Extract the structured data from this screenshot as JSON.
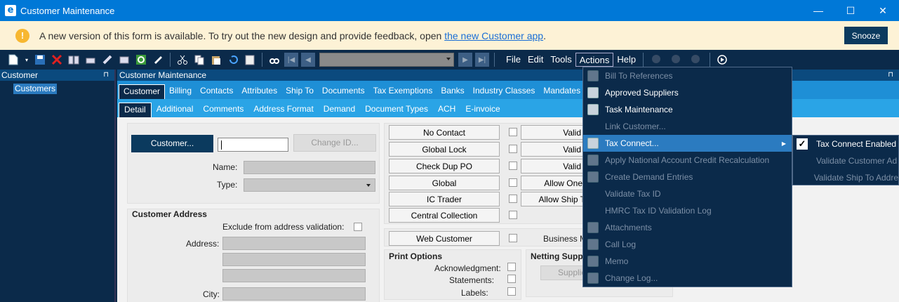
{
  "window": {
    "title": "Customer Maintenance",
    "minimize": "—",
    "maximize": "☐",
    "close": "✕"
  },
  "banner": {
    "message": "A new version of this form is available. To try out the new design and provide feedback, open ",
    "link": "the new Customer app",
    "period": ".",
    "snooze": "Snooze"
  },
  "menubar": {
    "file": "File",
    "edit": "Edit",
    "tools": "Tools",
    "actions": "Actions",
    "help": "Help"
  },
  "left_panel": {
    "title": "Customer",
    "pin": "⊓",
    "item": "Customers"
  },
  "main": {
    "title": "Customer Maintenance",
    "pin": "⊓",
    "tabs": [
      "Customer",
      "Billing",
      "Contacts",
      "Attributes",
      "Ship To",
      "Documents",
      "Tax Exemptions",
      "Banks",
      "Industry Classes",
      "Mandates"
    ],
    "subtabs": [
      "Detail",
      "Additional",
      "Comments",
      "Address Format",
      "Demand",
      "Document Types",
      "ACH",
      "E-invoice"
    ]
  },
  "form": {
    "customer_button": "Customer...",
    "change_id_button": "Change ID...",
    "name_label": "Name:",
    "type_label": "Type:",
    "address_heading": "Customer Address",
    "exclude_label": "Exclude from address validation:",
    "address_label": "Address:",
    "city_label": "City:",
    "buttons": [
      "No Contact",
      "Global Lock",
      "Check Dup PO",
      "Global",
      "IC Trader",
      "Central Collection"
    ],
    "right_buttons": [
      "Valid",
      "Valid",
      "Valid",
      "Allow One",
      "Allow Ship T"
    ],
    "web_customer": "Web Customer",
    "business_label": "Business M",
    "print_options": "Print Options",
    "acknowledgment": "Acknowledgment:",
    "statements": "Statements:",
    "labels": "Labels:",
    "netting": "Netting Suppli",
    "supplier_btn": "Supplie"
  },
  "actions_menu": {
    "items": [
      {
        "label": "Bill To References",
        "disabled": true
      },
      {
        "label": "Approved Suppliers",
        "disabled": false
      },
      {
        "label": "Task Maintenance",
        "disabled": false
      },
      {
        "label": "Link Customer...",
        "disabled": true
      },
      {
        "label": "Tax Connect...",
        "disabled": false,
        "hover": true,
        "submenu": true
      },
      {
        "label": "Apply National Account Credit Recalculation",
        "disabled": true
      },
      {
        "label": "Create Demand Entries",
        "disabled": true
      },
      {
        "label": "Validate Tax ID",
        "disabled": true
      },
      {
        "label": "HMRC Tax ID Validation Log",
        "disabled": true
      },
      {
        "label": "Attachments",
        "disabled": true
      },
      {
        "label": "Call Log",
        "disabled": true
      },
      {
        "label": "Memo",
        "disabled": true
      },
      {
        "label": "Change Log...",
        "disabled": true
      }
    ]
  },
  "tax_submenu": {
    "items": [
      {
        "label": "Tax Connect Enabled",
        "checked": true,
        "disabled": false
      },
      {
        "label": "Validate Customer Ad",
        "checked": false,
        "disabled": true
      },
      {
        "label": "Validate Ship To Addre",
        "checked": false,
        "disabled": true
      }
    ]
  }
}
